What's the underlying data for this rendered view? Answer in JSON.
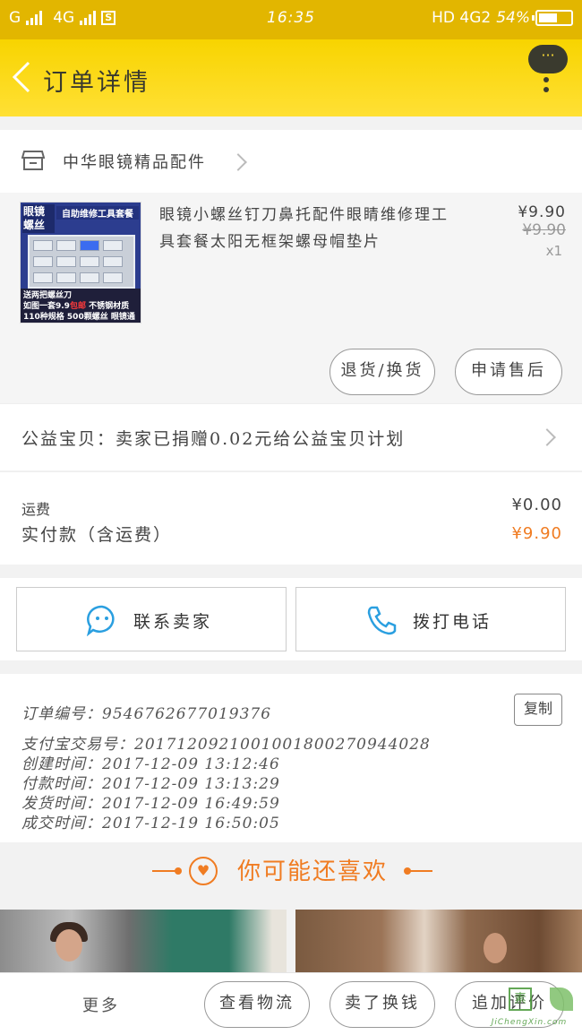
{
  "status": {
    "carrier1": "G",
    "carrier2": "4G",
    "time": "16:35",
    "net": "HD 4G2",
    "battery": "54%"
  },
  "nav": {
    "title": "订单详情",
    "bubble": "···"
  },
  "shop": {
    "name": "中华眼镜精品配件"
  },
  "product": {
    "title": "眼镜小螺丝钉刀鼻托配件眼睛维修理工具套餐太阳无框架螺母帽垫片",
    "price": "¥9.90",
    "original_price": "¥9.90",
    "qty": "x1",
    "thumb": {
      "tag": "眼镜螺丝",
      "header": "自助维修工具套餐",
      "line1": "送两把螺丝刀",
      "line2a": "如图一套9.9",
      "line2b": "包邮",
      "line2c": "不锈钢材质",
      "line3": "110种规格 500颗螺丝 眼镜通用"
    },
    "btn_refund": "退货/换货",
    "btn_after": "申请售后"
  },
  "charity": {
    "text": "公益宝贝：卖家已捐赠0.02元给公益宝贝计划"
  },
  "fee": {
    "shipping_label": "运费",
    "shipping": "¥0.00",
    "total_label": "实付款（含运费）",
    "total": "¥9.90"
  },
  "contact": {
    "seller": "联系卖家",
    "phone": "拨打电话"
  },
  "info": {
    "copy": "复制",
    "order_no": "订单编号：9546762677019376",
    "alipay_no": "支付宝交易号：2017120921001001800270944028",
    "created": "创建时间：2017-12-09 13:12:46",
    "paid": "付款时间：2017-12-09 13:13:29",
    "shipped": "发货时间：2017-12-09 16:49:59",
    "done": "成交时间：2017-12-19 16:50:05"
  },
  "recommend": {
    "title": "你可能还喜欢"
  },
  "bottom": {
    "more": "更多",
    "logistics": "查看物流",
    "sell": "卖了换钱",
    "review": "追加评价"
  },
  "watermark": {
    "url": "JiChengXin.com"
  },
  "colors": {
    "accent": "#f07c22",
    "nav": "#ffd800",
    "status": "#e2b600"
  }
}
